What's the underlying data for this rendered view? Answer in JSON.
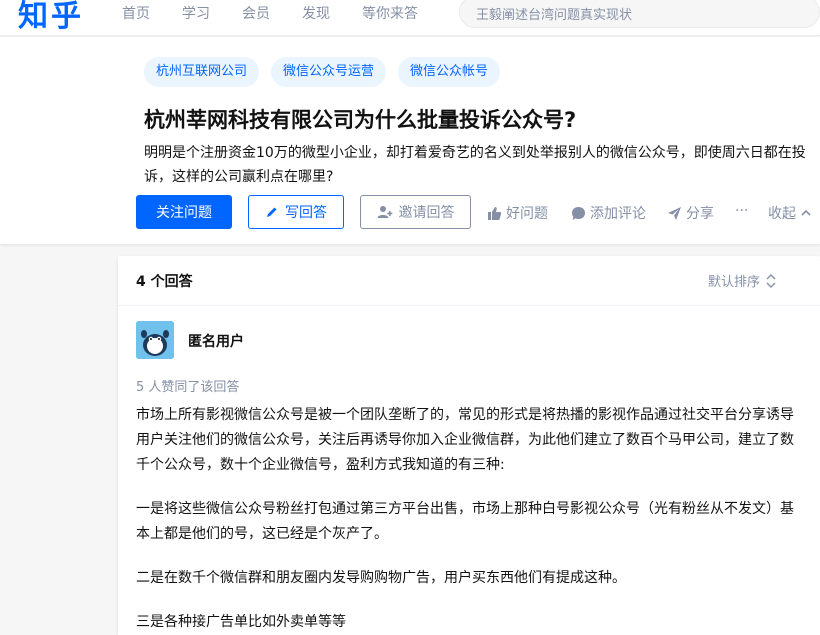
{
  "nav": {
    "logo": "知乎",
    "items": [
      "首页",
      "学习",
      "会员",
      "发现",
      "等你来答"
    ],
    "search_placeholder": "王毅阐述台湾问题真实现状"
  },
  "question": {
    "topics": [
      "杭州互联网公司",
      "微信公众号运营",
      "微信公众帐号"
    ],
    "title": "杭州莘网科技有限公司为什么批量投诉公众号?",
    "detail": "明明是个注册资金10万的微型小企业，却打着爱奇艺的名义到处举报别人的微信公众号，即使周六日都在投诉，这样的公司赢利点在哪里?",
    "follow_label": "关注问题",
    "write_label": "写回答",
    "invite_label": "邀请回答",
    "good_question_label": "好问题",
    "comment_label": "添加评论",
    "share_label": "分享",
    "more_label": "···",
    "collapse_label": "收起"
  },
  "answers": {
    "count_label": "4 个回答",
    "sort_label": "默认排序",
    "first": {
      "author": "匿名用户",
      "votes": "5 人赞同了该回答",
      "paragraphs": [
        "市场上所有影视微信公众号是被一个团队垄断了的，常见的形式是将热播的影视作品通过社交平台分享诱导用户关注他们的微信公众号，关注后再诱导你加入企业微信群，为此他们建立了数百个马甲公司，建立了数千个公众号，数十个企业微信号，盈利方式我知道的有三种:",
        "一是将这些微信公众号粉丝打包通过第三方平台出售，市场上那种白号影视公众号（光有粉丝从不发文）基本上都是他们的号，这已经是个灰产了。",
        "二是在数千个微信群和朋友圈内发导购购物广告，用户买东西他们有提成这种。",
        "三是各种接广告单比如外卖单等等"
      ]
    }
  },
  "colors": {
    "brand": "#0066ff",
    "muted": "#8590a6",
    "topic_bg": "#ebf5ff"
  }
}
